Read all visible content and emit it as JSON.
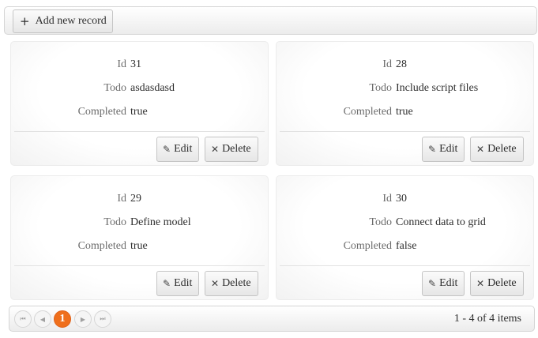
{
  "toolbar": {
    "add_label": "Add new record",
    "add_icon": "plus-icon"
  },
  "fields": {
    "id": "Id",
    "todo": "Todo",
    "completed": "Completed"
  },
  "actions": {
    "edit_label": "Edit",
    "delete_label": "Delete"
  },
  "records": [
    {
      "id": "31",
      "todo": "asdasdasd",
      "completed": "true"
    },
    {
      "id": "28",
      "todo": "Include script files",
      "completed": "true"
    },
    {
      "id": "29",
      "todo": "Define model",
      "completed": "true"
    },
    {
      "id": "30",
      "todo": "Connect data to grid",
      "completed": "false"
    }
  ],
  "pager": {
    "current_page": "1",
    "info": "1 - 4 of 4 items"
  },
  "colors": {
    "accent": "#ef6f1c",
    "border": "#d5d5d5",
    "label": "#6b6b6b"
  }
}
